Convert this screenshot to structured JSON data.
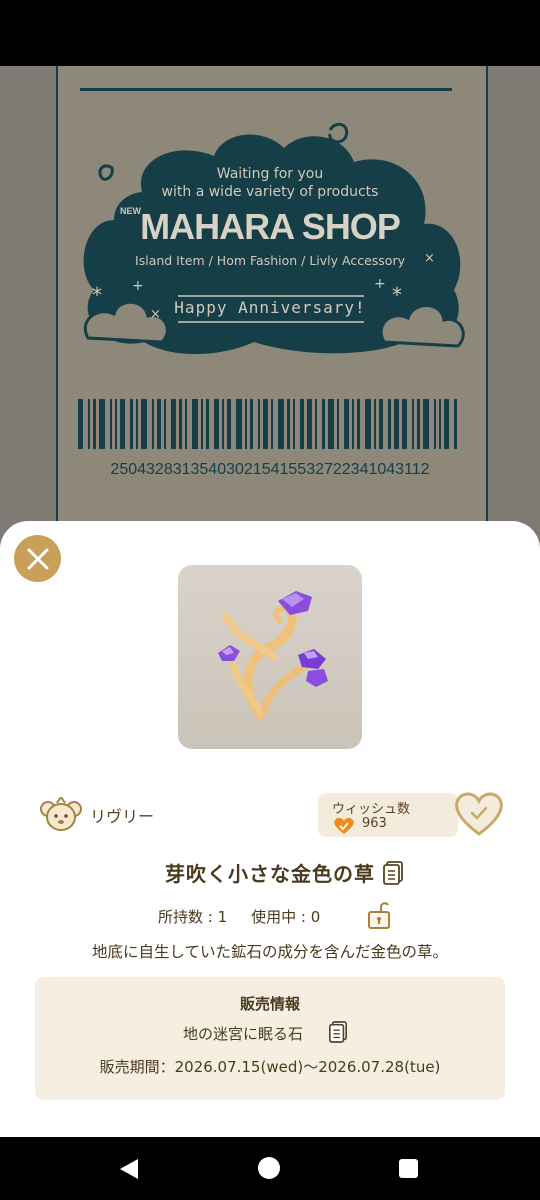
{
  "background_ticket": {
    "tagline_line1": "Waiting for you",
    "tagline_line2": "with a wide variety of products",
    "shop_badge": "NEW",
    "shop_name": "MAHARA SHOP",
    "categories": "Island Item / Hom Fashion / Livly Accessory",
    "banner": "Happy Anniversary!",
    "barcode_number": "25043283135403021541553272234104 3112"
  },
  "item": {
    "image_icon": "golden-crystal-plant-icon",
    "brand_name": "リヴリー",
    "brand_icon": "livly-face-icon",
    "wish_label": "ウィッシュ数",
    "wish_count": "963",
    "name": "芽吹く小さな金色の草",
    "owned_count_text": "所持数 : 1",
    "in_use_text": "使用中 : 0",
    "description": "地底に自生していた鉱石の成分を含んだ金色の草。"
  },
  "sale_info": {
    "title": "販売情報",
    "source": "地の迷宮に眠る石",
    "period": "販売期間：2026.07.15(wed)〜2026.07.28(tue)"
  },
  "colors": {
    "accent_gold": "#c9a05a",
    "text_brown": "#4a3a1e",
    "ticket_teal": "#163e47",
    "sale_bg": "#f6efe1",
    "wish_orange": "#f08a1c"
  }
}
